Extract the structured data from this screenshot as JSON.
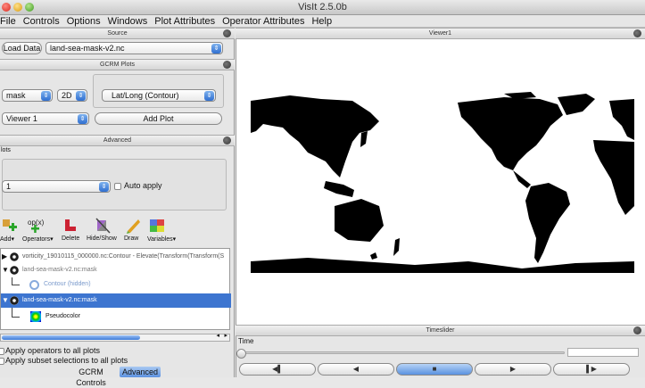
{
  "window": {
    "title": "VisIt 2.5.0b"
  },
  "menu": [
    "File",
    "Controls",
    "Options",
    "Windows",
    "Plot Attributes",
    "Operator Attributes",
    "Help"
  ],
  "source": {
    "header": "Source",
    "load_label": "Load Data",
    "file_value": "land-sea-mask-v2.nc"
  },
  "gcrm": {
    "header": "GCRM Plots",
    "variable": "mask",
    "dimension": "2D",
    "plot_type": "Lat/Long (Contour)",
    "viewer": "Viewer 1",
    "add_plot_label": "Add Plot"
  },
  "advanced": {
    "header": "Advanced",
    "plots_label": "lots",
    "window_value": "1",
    "auto_apply_label": "Auto apply",
    "toolbar": {
      "add": "Add",
      "operators": "Operators",
      "delete": "Delete",
      "hide_show": "Hide/Show",
      "draw": "Draw",
      "variables": "Variables",
      "op_glyph": "op(x)"
    },
    "tree": [
      "vorticity_19010115_000000.nc:Contour - Elevate(Transform(Transform(S",
      "land-sea-mask-v2.nc:mask",
      "Contour (hidden)",
      "land-sea-mask-v2.nc:mask",
      "Pseudocolor"
    ],
    "apply_operators_label": "Apply operators to all plots",
    "apply_subset_label": "Apply subset selections to all plots"
  },
  "bottom_tabs": [
    "GCRM Controls",
    "Advanced"
  ],
  "viewer": {
    "header": "Viewer1"
  },
  "timeslider": {
    "header": "Timeslider",
    "time_label": "Time"
  },
  "colors": {
    "selection": "#3d75d0",
    "accent": "#3c6fd8"
  }
}
